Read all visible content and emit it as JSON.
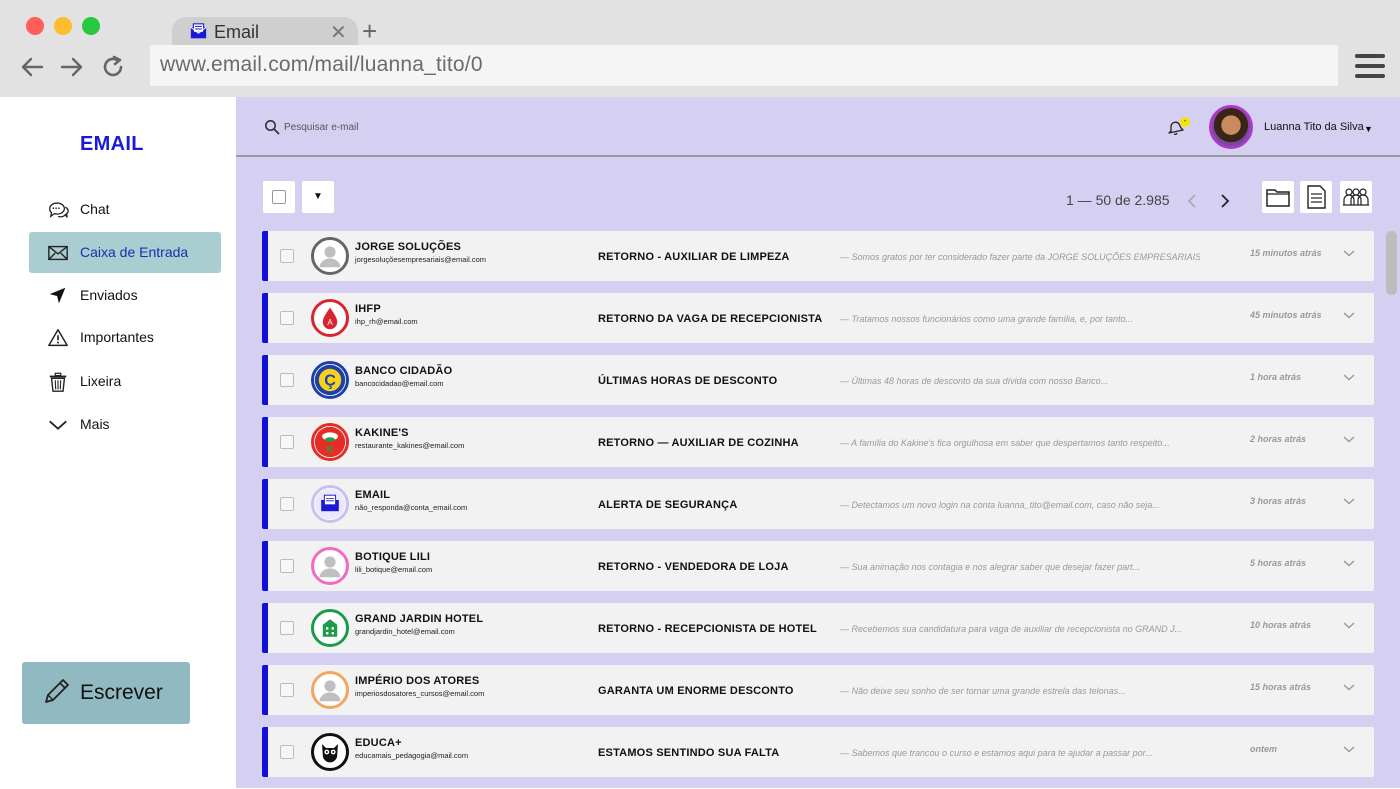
{
  "browser": {
    "tab_title": "Email",
    "url": "www.email.com/mail/luanna_tito/0"
  },
  "sidebar": {
    "brand": "EMAIL",
    "items": [
      {
        "label": "Chat",
        "icon": "chat-bubbles-icon"
      },
      {
        "label": "Caixa de Entrada",
        "icon": "envelope-icon",
        "active": true
      },
      {
        "label": "Enviados",
        "icon": "send-arrow-icon"
      },
      {
        "label": "Importantes",
        "icon": "warning-icon"
      },
      {
        "label": "Lixeira",
        "icon": "trash-icon"
      },
      {
        "label": "Mais",
        "icon": "chevron-down-icon"
      }
    ],
    "compose_label": "Escrever"
  },
  "header": {
    "search_placeholder": "Pesquisar e-mail",
    "user_name": "Luanna Tito da Silva"
  },
  "toolbar": {
    "pager": "1 — 50 de 2.985"
  },
  "colors": {
    "brand": "#1a1ad6",
    "row_accent": "#1010d8",
    "main_bg": "#d5d0f2",
    "active_nav": "#a9cdd0",
    "compose_bg": "#91b9c2"
  },
  "emails": [
    {
      "sender": "JORGE SOLUÇÕES",
      "email": "jorgesoluçõesempresariais@email.com",
      "subject": "RETORNO - AUXILIAR DE LIMPEZA",
      "preview": "— Somos gratos por ter considerado fazer parte da JORGE SOLUÇÕES EMPRESARIAIS...",
      "time": "15 minutos atrás",
      "avatar_color": "#666666",
      "avatar_type": "person"
    },
    {
      "sender": "IHFP",
      "email": "ihp_rh@email.com",
      "subject": "RETORNO DA VAGA DE RECEPCIONISTA",
      "preview": "— Tratamos nossos funcionários como uma grande família, e, por tanto...",
      "time": "45 minutos atrás",
      "avatar_color": "#d9262e",
      "avatar_type": "drop"
    },
    {
      "sender": "BANCO CIDADÃO",
      "email": "bancocidadao@email.com",
      "subject": "ÚLTIMAS HORAS DE DESCONTO",
      "preview": "— Últimas 48 horas de desconto da sua dívida com nosso Banco...",
      "time": "1 hora atrás",
      "avatar_color": "#1f3fa8",
      "avatar_type": "coin"
    },
    {
      "sender": "KAKINE'S",
      "email": "restaurante_kakines@email.com",
      "subject": "RETORNO — AUXILIAR DE COZINHA",
      "preview": "— A família do Kakine's fica orgulhosa em saber que despertamos tanto respeito...",
      "time": "2 horas atrás",
      "avatar_color": "#e52d27",
      "avatar_type": "chef"
    },
    {
      "sender": "EMAIL",
      "email": "não_responda@conta_email.com",
      "subject": "ALERTA DE SEGURANÇA",
      "preview": "— Detectamos um novo login na conta luanna_tito@email.com, caso não seja...",
      "time": "3 horas atrás",
      "avatar_color": "#c9c0f0",
      "avatar_type": "envelope"
    },
    {
      "sender": "BOTIQUE LILI",
      "email": "lili_botique@email.com",
      "subject": "RETORNO - VENDEDORA DE LOJA",
      "preview": "— Sua animação nos contagia e nos alegrar saber que desejar fazer part...",
      "time": "5 horas atrás",
      "avatar_color": "#f06bbf",
      "avatar_type": "person"
    },
    {
      "sender": "GRAND JARDIN HOTEL",
      "email": "grandjardin_hotel@email.com",
      "subject": "RETORNO - RECEPCIONISTA DE HOTEL",
      "preview": "— Recebemos sua candidatura para vaga de auxiliar de recepcionista no GRAND J...",
      "time": "10 horas atrás",
      "avatar_color": "#1e9a4a",
      "avatar_type": "building"
    },
    {
      "sender": "IMPÉRIO DOS ATORES",
      "email": "imperiosdosatores_cursos@email.com",
      "subject": "GARANTA UM ENORME DESCONTO",
      "preview": "— Não deixe seu sonho de ser tornar uma grande estrela das telonas...",
      "time": "15 horas atrás",
      "avatar_color": "#f0a860",
      "avatar_type": "person"
    },
    {
      "sender": "EDUCA+",
      "email": "educamais_pedagogia@mail.com",
      "subject": "ESTAMOS SENTINDO SUA FALTA",
      "preview": "— Sabemos que trancou o curso e estamos aqui para te ajudar a passar por...",
      "time": "ontem",
      "avatar_color": "#111111",
      "avatar_type": "owl"
    }
  ]
}
